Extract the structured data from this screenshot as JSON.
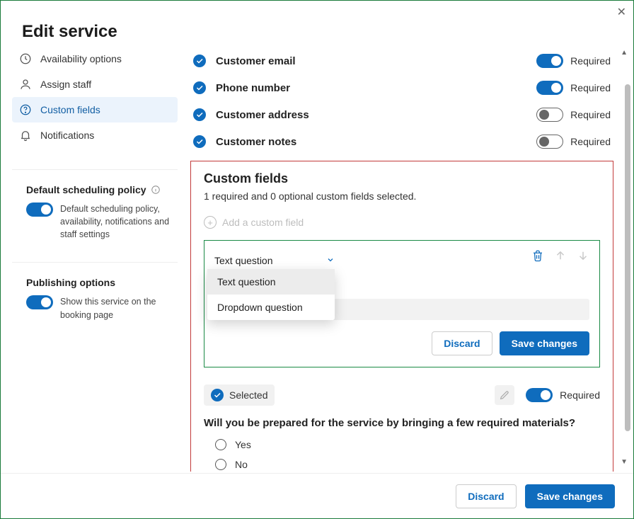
{
  "pageTitle": "Edit service",
  "nav": {
    "items": [
      {
        "label": "Availability options"
      },
      {
        "label": "Assign staff"
      },
      {
        "label": "Custom fields"
      },
      {
        "label": "Notifications"
      }
    ]
  },
  "policy": {
    "title": "Default scheduling policy",
    "desc": "Default scheduling policy, availability, notifications and staff settings"
  },
  "publishing": {
    "title": "Publishing options",
    "desc": "Show this service on the booking page"
  },
  "defaultFields": [
    {
      "label": "Customer email",
      "requiredOn": true
    },
    {
      "label": "Phone number",
      "requiredOn": true
    },
    {
      "label": "Customer address",
      "requiredOn": false
    },
    {
      "label": "Customer notes",
      "requiredOn": false
    }
  ],
  "requiredLabel": "Required",
  "custom": {
    "title": "Custom fields",
    "subtitle": "1 required and 0 optional custom fields selected.",
    "addLabel": "Add a custom field",
    "typeSelected": "Text question",
    "typeOptions": [
      "Text question",
      "Dropdown question"
    ],
    "discard": "Discard",
    "save": "Save changes"
  },
  "question": {
    "selectedChip": "Selected",
    "required": "Required",
    "text": "Will you be prepared for the service by bringing a few required materials?",
    "options": [
      "Yes",
      "No"
    ]
  },
  "footer": {
    "discard": "Discard",
    "save": "Save changes"
  }
}
